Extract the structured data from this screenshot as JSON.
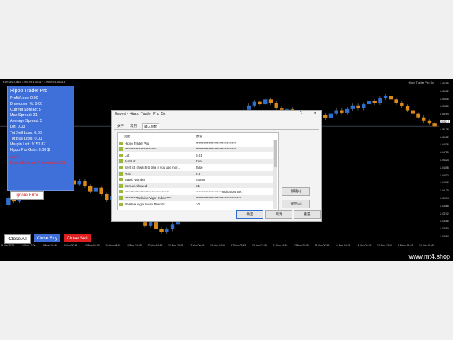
{
  "chart": {
    "symbol_line": "EURUSD,M15  1.05199 1.05217 1.05199 1.05213",
    "ea_label": "Hippo Trader Pro_5x",
    "price_ticks": [
      "1.05758",
      "1.05632",
      "1.05506",
      "1.05380",
      "1.05254",
      "1.05213",
      "1.05128",
      "1.05002",
      "1.04876",
      "1.04750",
      "1.04624",
      "1.04498",
      "1.04372",
      "1.04246",
      "1.04120",
      "1.03994",
      "1.03868",
      "1.03742",
      "1.03616",
      "1.03490",
      "1.03364"
    ],
    "highlight_price": "1.05213",
    "time_ticks": [
      "8 Nov 2023",
      "9 Nov 12:00",
      "9 Nov 16:45",
      "9 Nov 20:45",
      "10 Nov 04:00",
      "10 Nov 08:45",
      "10 Nov 12:45",
      "10 Nov 16:45",
      "10 Nov 20:45",
      "13 Nov 00:45",
      "13 Nov 04:45",
      "13 Nov 08:45",
      "13 Nov 12:45",
      "13 Nov 16:45",
      "13 Nov 20:45",
      "14 Nov 00:45",
      "14 Nov 04:45",
      "14 Nov 08:45",
      "14 Nov 12:45",
      "14 Nov 16:45",
      "14 Nov 20:45"
    ],
    "watermark": "www.mt4.shop",
    "candles": [
      [
        1.039,
        1.0402
      ],
      [
        1.0402,
        1.0396
      ],
      [
        1.0396,
        1.041
      ],
      [
        1.041,
        1.0405
      ],
      [
        1.0405,
        1.0418
      ],
      [
        1.0418,
        1.0412
      ],
      [
        1.0412,
        1.0425
      ],
      [
        1.0425,
        1.042
      ],
      [
        1.042,
        1.0432
      ],
      [
        1.0432,
        1.0428
      ],
      [
        1.0428,
        1.0437
      ],
      [
        1.0437,
        1.0431
      ],
      [
        1.0431,
        1.0424
      ],
      [
        1.0424,
        1.043
      ],
      [
        1.043,
        1.0421
      ],
      [
        1.0421,
        1.0412
      ],
      [
        1.0412,
        1.0419
      ],
      [
        1.0419,
        1.0408
      ],
      [
        1.0408,
        1.0398
      ],
      [
        1.0398,
        1.0405
      ],
      [
        1.0405,
        1.0392
      ],
      [
        1.0392,
        1.038
      ],
      [
        1.038,
        1.037
      ],
      [
        1.037,
        1.0378
      ],
      [
        1.0378,
        1.0364
      ],
      [
        1.0364,
        1.0355
      ],
      [
        1.0355,
        1.0362
      ],
      [
        1.0362,
        1.035
      ],
      [
        1.035,
        1.0345
      ],
      [
        1.0345,
        1.0349
      ],
      [
        1.0349,
        1.0358
      ],
      [
        1.0358,
        1.0378
      ],
      [
        1.0378,
        1.0396
      ],
      [
        1.0396,
        1.0415
      ],
      [
        1.0415,
        1.0432
      ],
      [
        1.0432,
        1.0448
      ],
      [
        1.0448,
        1.046
      ],
      [
        1.046,
        1.0472
      ],
      [
        1.0472,
        1.0488
      ],
      [
        1.0488,
        1.05
      ],
      [
        1.05,
        1.0512
      ],
      [
        1.0512,
        1.0526
      ],
      [
        1.0526,
        1.054
      ],
      [
        1.054,
        1.0548
      ],
      [
        1.0548,
        1.0556
      ],
      [
        1.0556,
        1.0562
      ],
      [
        1.0562,
        1.0558
      ],
      [
        1.0558,
        1.0566
      ],
      [
        1.0566,
        1.056
      ],
      [
        1.056,
        1.0552
      ],
      [
        1.0552,
        1.0545
      ],
      [
        1.0545,
        1.055
      ],
      [
        1.055,
        1.0542
      ],
      [
        1.0542,
        1.0536
      ],
      [
        1.0536,
        1.053
      ],
      [
        1.053,
        1.0538
      ],
      [
        1.0538,
        1.0545
      ],
      [
        1.0545,
        1.054
      ],
      [
        1.054,
        1.0535
      ],
      [
        1.0535,
        1.0542
      ],
      [
        1.0542,
        1.0548
      ],
      [
        1.0548,
        1.0544
      ],
      [
        1.0544,
        1.055
      ],
      [
        1.055,
        1.0556
      ],
      [
        1.0556,
        1.0551
      ],
      [
        1.0551,
        1.0558
      ],
      [
        1.0558,
        1.0563
      ],
      [
        1.0563,
        1.056
      ],
      [
        1.056,
        1.0568
      ],
      [
        1.0568,
        1.0572
      ],
      [
        1.0572,
        1.0566
      ],
      [
        1.0566,
        1.056
      ],
      [
        1.056,
        1.0555
      ],
      [
        1.0555,
        1.0548
      ],
      [
        1.0548,
        1.0542
      ],
      [
        1.0542,
        1.0536
      ],
      [
        1.0536,
        1.053
      ],
      [
        1.053,
        1.0526
      ],
      [
        1.0526,
        1.0521
      ]
    ]
  },
  "panel": {
    "title": "Hippo Trader Pro",
    "profit_loss": "Profit/Loss: 0.00",
    "drawdown": "Drawdown %: 0.00",
    "current_spread": "Current Spread: 5",
    "max_spread": "Max Spread: 31",
    "average_spread": "Average Spread: 5",
    "lot": "Lot: 0.03",
    "sell_loss": "Tot Sell Loss: 0.00",
    "buy_loss": "Tot Buy Loss: 0.00",
    "margin_left": "Margin Left: 9157.87",
    "gain": "Hippo Pro Gain: 0.00 $",
    "alert_title": "Alert:",
    "alert_text": "Equity/Balance Protection is ON",
    "ignore_error": "Ignore Error"
  },
  "controls": {
    "close_all": "Close All",
    "close_buy": "Close Buy",
    "close_sell": "Close Sell"
  },
  "dialog": {
    "title": "Expert - Hippo Trader Pro_5x",
    "help": "?",
    "close": "✕",
    "tabs": [
      "关于",
      "常用",
      "输入参数"
    ],
    "col_variable": "变量",
    "col_value": "数值",
    "rows": [
      {
        "k": "Hippo Trader Pro",
        "v": "********************************"
      },
      {
        "k": "**************************",
        "v": "********************************"
      },
      {
        "k": "Lot",
        "v": "0.01"
      },
      {
        "k": "AutoLot",
        "v": "true"
      },
      {
        "k": "Sent lot (Switch to true if you use mor...",
        "v": "false"
      },
      {
        "k": "Risk",
        "v": "5.0"
      },
      {
        "k": "Magic Number",
        "v": "93856"
      },
      {
        "k": "Spread Allowed",
        "v": "31"
      },
      {
        "k": "************************************",
        "v": "*********************Indicators Se..."
      },
      {
        "k": "**********Relative Vigor Index*****",
        "v": "************************************"
      },
      {
        "k": "Relative Vigor Index Periods",
        "v": "10"
      }
    ],
    "btn_load": "加载(L)",
    "btn_save": "保存(S)",
    "btn_ok": "确定",
    "btn_cancel": "取消",
    "btn_reset": "重置"
  }
}
